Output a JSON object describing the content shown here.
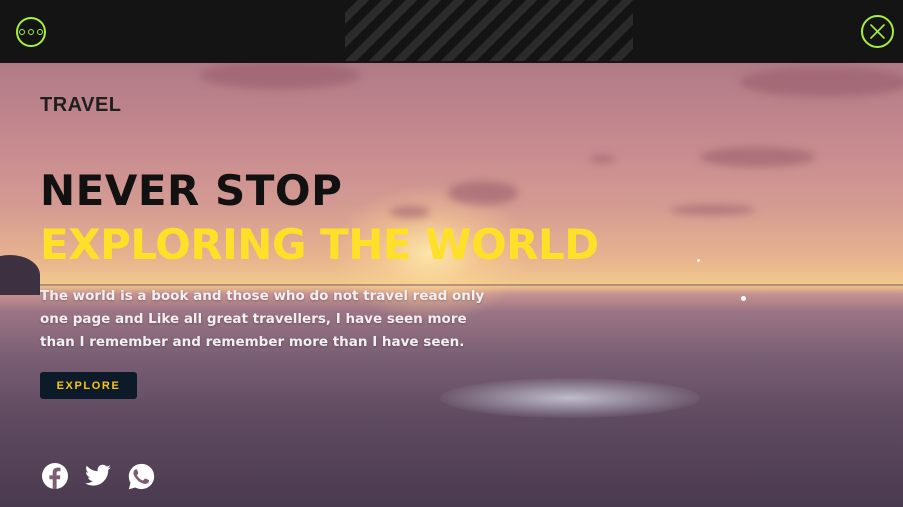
{
  "topbar": {
    "menu_icon": "more-horizontal-circle-icon",
    "close_icon": "close-circle-icon",
    "accent_color": "#a6ef3a"
  },
  "hero": {
    "brand": "TRAVEL",
    "headline_line1": "NEVER STOP",
    "headline_line2": "EXPLORING THE WORLD",
    "description": "The world is a book and those who do not travel read only one page and Like all great travellers, I have seen more than I remember and remember more than I have seen.",
    "cta_label": "EXPLORE",
    "headline_accent_color": "#ffe028",
    "cta_text_color": "#f5c518",
    "cta_bg_color": "#0d1a2a"
  },
  "social": [
    {
      "name": "facebook",
      "icon": "facebook-icon"
    },
    {
      "name": "twitter",
      "icon": "twitter-icon"
    },
    {
      "name": "whatsapp",
      "icon": "whatsapp-icon"
    }
  ]
}
